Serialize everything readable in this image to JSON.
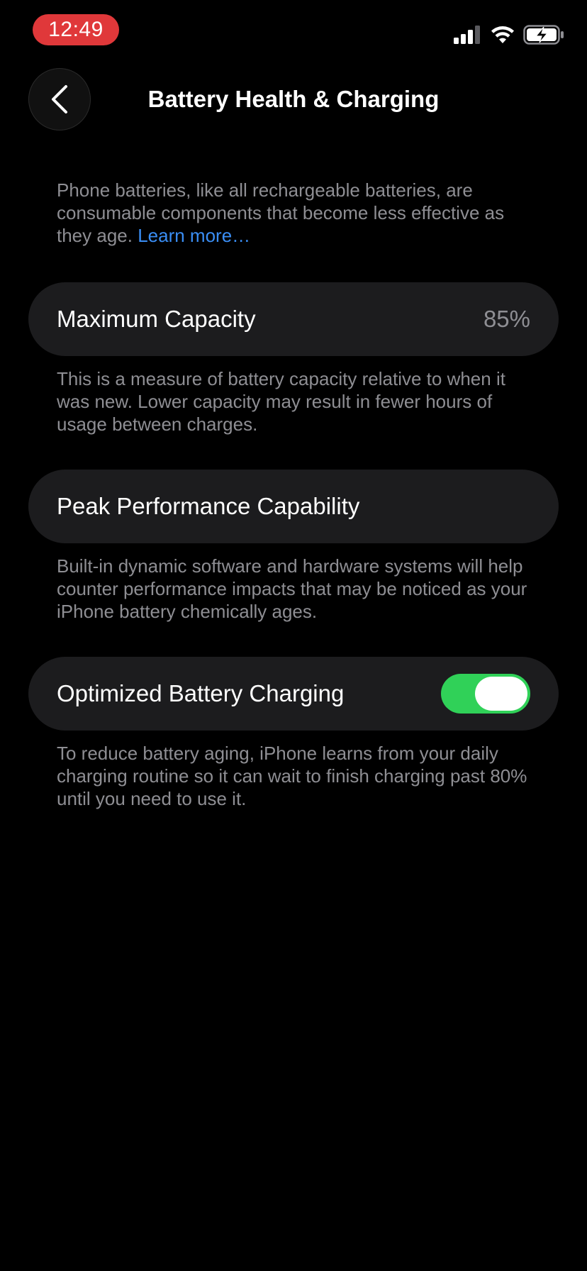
{
  "status_bar": {
    "time": "12:49",
    "time_pill_color": "#e0383a",
    "icons": [
      "cellular-signal-icon",
      "wifi-icon",
      "battery-charging-icon"
    ]
  },
  "nav": {
    "back_icon": "chevron-left-icon",
    "title": "Battery Health & Charging"
  },
  "intro": {
    "text": "Phone batteries, like all rechargeable batteries, are consumable components that become less effective as they age. ",
    "link_label": "Learn more…",
    "link_color": "#3a8ef5"
  },
  "maximum_capacity": {
    "label": "Maximum Capacity",
    "value": "85%",
    "footer": "This is a measure of battery capacity relative to when it was new. Lower capacity may result in fewer hours of usage between charges."
  },
  "peak_performance": {
    "label": "Peak Performance Capability",
    "footer": "Built-in dynamic software and hardware systems will help counter performance impacts that may be noticed as your iPhone battery chemically ages."
  },
  "optimized_charging": {
    "label": "Optimized Battery Charging",
    "enabled": true,
    "toggle_color": "#30d158",
    "footer": "To reduce battery aging, iPhone learns from your daily charging routine so it can wait to finish charging past 80% until you need to use it."
  }
}
